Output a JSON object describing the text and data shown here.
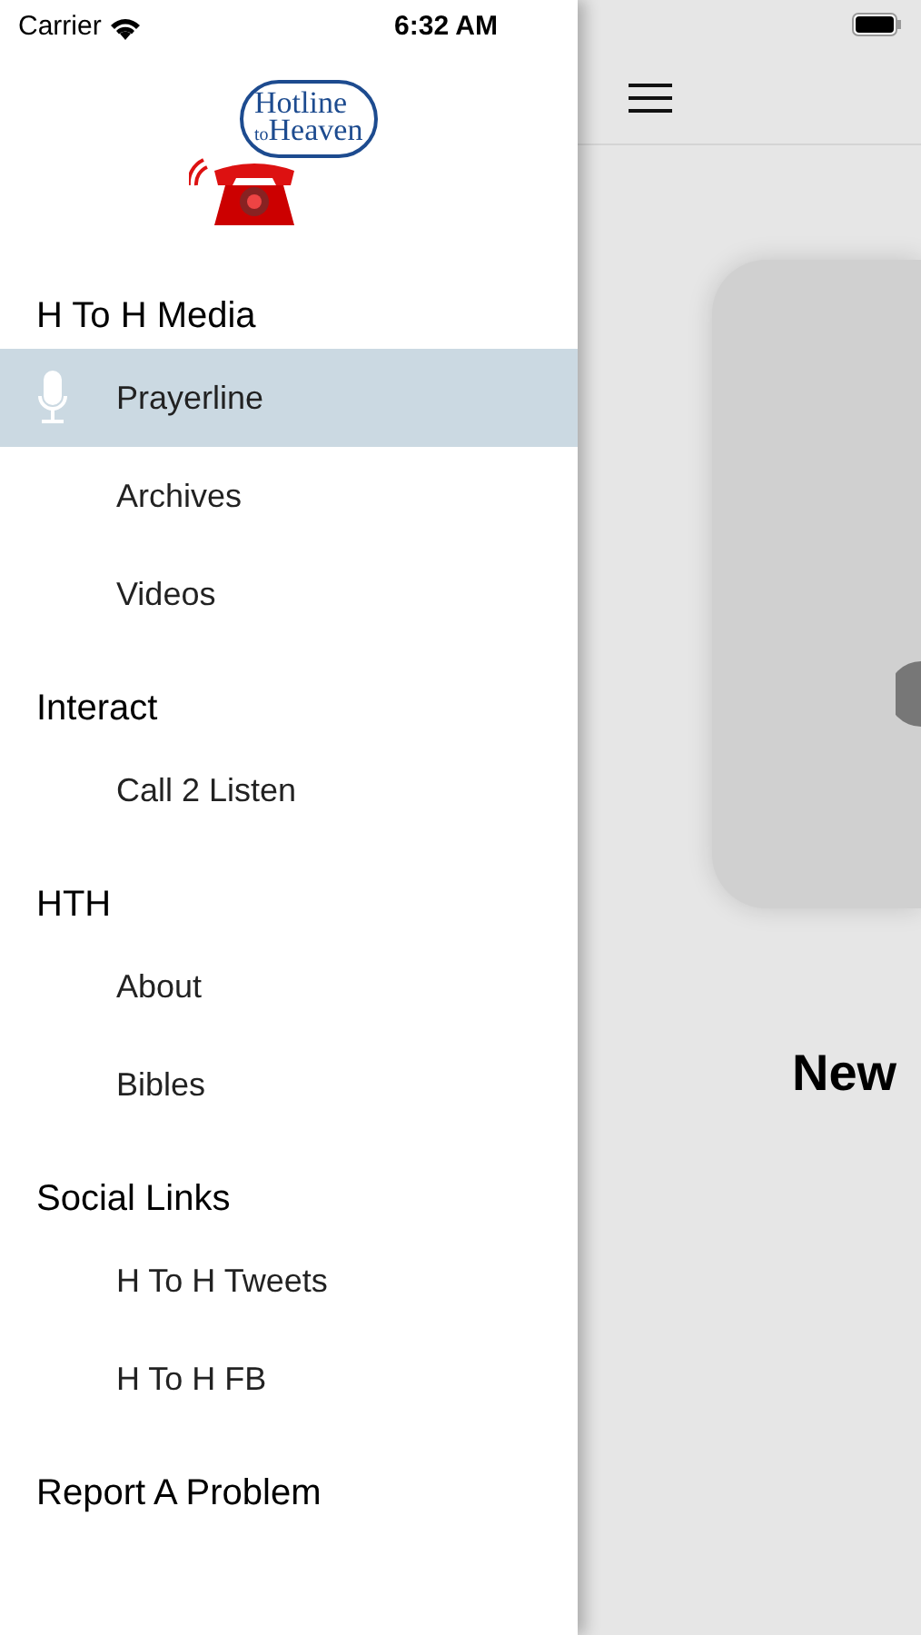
{
  "status_bar": {
    "carrier": "Carrier",
    "time": "6:32 AM"
  },
  "logo": {
    "line1": "Hotline",
    "line2": "to",
    "line3": "Heaven"
  },
  "sections": [
    {
      "title": "H To H Media",
      "items": [
        {
          "label": "Prayerline",
          "selected": true,
          "kind": "mic"
        },
        {
          "label": "Archives",
          "selected": false
        },
        {
          "label": "Videos",
          "selected": false
        }
      ]
    },
    {
      "title": "Interact",
      "items": [
        {
          "label": "Call 2 Listen",
          "selected": false
        }
      ]
    },
    {
      "title": "HTH",
      "items": [
        {
          "label": "About",
          "selected": false
        },
        {
          "label": "Bibles",
          "selected": false
        }
      ]
    },
    {
      "title": "Social Links",
      "items": [
        {
          "label": "H To H Tweets",
          "selected": false
        },
        {
          "label": "H To H FB",
          "selected": false
        }
      ]
    },
    {
      "title": "Report A Problem"
    }
  ],
  "content": {
    "heading": "New"
  }
}
